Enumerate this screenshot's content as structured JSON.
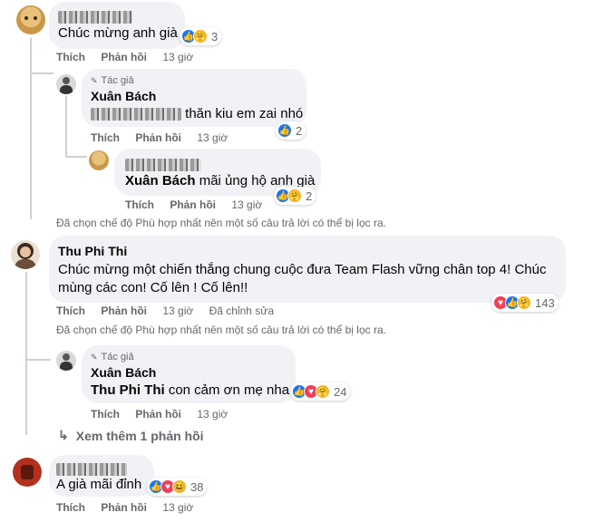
{
  "actions": {
    "like": "Thích",
    "reply": "Phản hồi",
    "edited": "Đã chỉnh sửa"
  },
  "notice": "Đã chọn chế độ Phù hợp nhất nên một số câu trả lời có thể bị lọc ra.",
  "author_tag": "Tác giả",
  "comments": [
    {
      "text": "Chúc mừng anh già",
      "time": "13 giờ",
      "reaction_count": "3",
      "reactions": [
        "like-icon",
        "care-icon"
      ],
      "replies": [
        {
          "author": "Xuân Bách",
          "text": "thăn kiu em zai nhó",
          "time": "13 giờ",
          "reaction_count": "2",
          "reactions": [
            "like-icon"
          ]
        },
        {
          "mention": "Xuân Bách",
          "text": "mãi ủng hộ anh già",
          "time": "13 giờ",
          "reaction_count": "2",
          "reactions": [
            "like-icon",
            "care-icon"
          ]
        }
      ]
    },
    {
      "author": "Thu Phi Thi",
      "text_line1": "Chúc mừng một chiến thắng chung cuộc đưa Team Flash vững chân top 4! Chúc",
      "text_line2": "mùng các con! Cố lên ! Cố lên!!",
      "time": "13 giờ",
      "reaction_count": "143",
      "reactions": [
        "love-icon",
        "like-icon",
        "care-icon"
      ],
      "replies": [
        {
          "author": "Xuân Bách",
          "mention": "Thu Phi Thi",
          "text": "con cảm ơn mẹ nha",
          "time": "13 giờ",
          "reaction_count": "24",
          "reactions": [
            "like-icon",
            "love-icon",
            "care-icon"
          ]
        }
      ],
      "view_more": "Xem thêm 1 phản hồi"
    },
    {
      "text": "A già mãi đỉnh",
      "time": "13 giờ",
      "reaction_count": "38",
      "reactions": [
        "like-icon",
        "love-icon",
        "haha-icon"
      ]
    }
  ]
}
